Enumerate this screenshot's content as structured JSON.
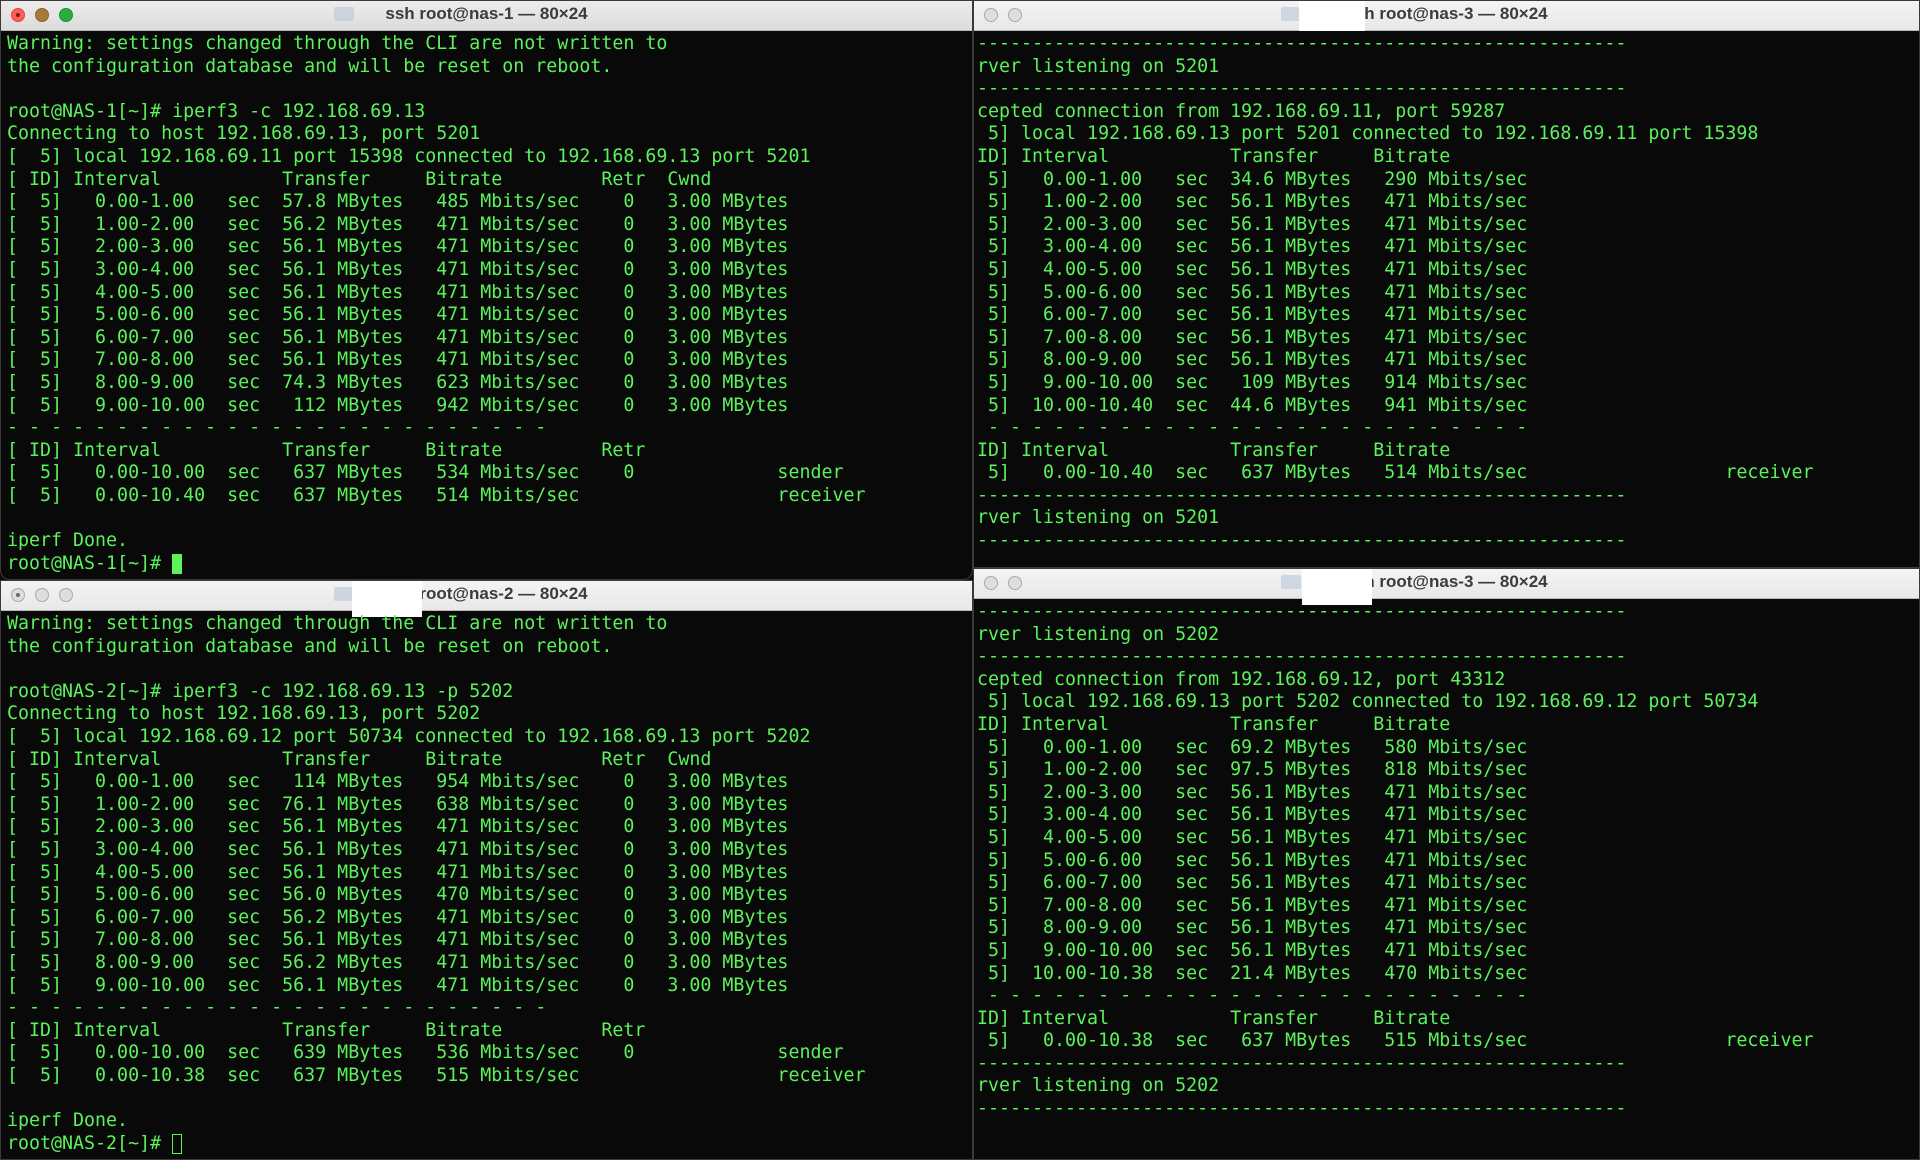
{
  "windows": {
    "top_left": {
      "title": "ssh root@nas-1 — 80×24",
      "text": "Warning: settings changed through the CLI are not written to\nthe configuration database and will be reset on reboot.\n\nroot@NAS-1[~]# iperf3 -c 192.168.69.13\nConnecting to host 192.168.69.13, port 5201\n[  5] local 192.168.69.11 port 15398 connected to 192.168.69.13 port 5201\n[ ID] Interval           Transfer     Bitrate         Retr  Cwnd\n[  5]   0.00-1.00   sec  57.8 MBytes   485 Mbits/sec    0   3.00 MBytes\n[  5]   1.00-2.00   sec  56.2 MBytes   471 Mbits/sec    0   3.00 MBytes\n[  5]   2.00-3.00   sec  56.1 MBytes   471 Mbits/sec    0   3.00 MBytes\n[  5]   3.00-4.00   sec  56.1 MBytes   471 Mbits/sec    0   3.00 MBytes\n[  5]   4.00-5.00   sec  56.1 MBytes   471 Mbits/sec    0   3.00 MBytes\n[  5]   5.00-6.00   sec  56.1 MBytes   471 Mbits/sec    0   3.00 MBytes\n[  5]   6.00-7.00   sec  56.1 MBytes   471 Mbits/sec    0   3.00 MBytes\n[  5]   7.00-8.00   sec  56.1 MBytes   471 Mbits/sec    0   3.00 MBytes\n[  5]   8.00-9.00   sec  74.3 MBytes   623 Mbits/sec    0   3.00 MBytes\n[  5]   9.00-10.00  sec   112 MBytes   942 Mbits/sec    0   3.00 MBytes\n- - - - - - - - - - - - - - - - - - - - - - - - -\n[ ID] Interval           Transfer     Bitrate         Retr\n[  5]   0.00-10.00  sec   637 MBytes   534 Mbits/sec    0             sender\n[  5]   0.00-10.40  sec   637 MBytes   514 Mbits/sec                  receiver\n\niperf Done.\nroot@NAS-1[~]# "
    },
    "top_right": {
      "title": "ssh root@nas-3 — 80×24",
      "text": "-----------------------------------------------------------\nrver listening on 5201\n-----------------------------------------------------------\ncepted connection from 192.168.69.11, port 59287\n 5] local 192.168.69.13 port 5201 connected to 192.168.69.11 port 15398\nID] Interval           Transfer     Bitrate\n 5]   0.00-1.00   sec  34.6 MBytes   290 Mbits/sec\n 5]   1.00-2.00   sec  56.1 MBytes   471 Mbits/sec\n 5]   2.00-3.00   sec  56.1 MBytes   471 Mbits/sec\n 5]   3.00-4.00   sec  56.1 MBytes   471 Mbits/sec\n 5]   4.00-5.00   sec  56.1 MBytes   471 Mbits/sec\n 5]   5.00-6.00   sec  56.1 MBytes   471 Mbits/sec\n 5]   6.00-7.00   sec  56.1 MBytes   471 Mbits/sec\n 5]   7.00-8.00   sec  56.1 MBytes   471 Mbits/sec\n 5]   8.00-9.00   sec  56.1 MBytes   471 Mbits/sec\n 5]   9.00-10.00  sec   109 MBytes   914 Mbits/sec\n 5]  10.00-10.40  sec  44.6 MBytes   941 Mbits/sec\n - - - - - - - - - - - - - - - - - - - - - - - - -\nID] Interval           Transfer     Bitrate\n 5]   0.00-10.40  sec   637 MBytes   514 Mbits/sec                  receiver\n-----------------------------------------------------------\nrver listening on 5201\n-----------------------------------------------------------"
    },
    "bottom_left": {
      "title": "ssh root@nas-2 — 80×24",
      "text": "Warning: settings changed through the CLI are not written to\nthe configuration database and will be reset on reboot.\n\nroot@NAS-2[~]# iperf3 -c 192.168.69.13 -p 5202\nConnecting to host 192.168.69.13, port 5202\n[  5] local 192.168.69.12 port 50734 connected to 192.168.69.13 port 5202\n[ ID] Interval           Transfer     Bitrate         Retr  Cwnd\n[  5]   0.00-1.00   sec   114 MBytes   954 Mbits/sec    0   3.00 MBytes\n[  5]   1.00-2.00   sec  76.1 MBytes   638 Mbits/sec    0   3.00 MBytes\n[  5]   2.00-3.00   sec  56.1 MBytes   471 Mbits/sec    0   3.00 MBytes\n[  5]   3.00-4.00   sec  56.1 MBytes   471 Mbits/sec    0   3.00 MBytes\n[  5]   4.00-5.00   sec  56.1 MBytes   471 Mbits/sec    0   3.00 MBytes\n[  5]   5.00-6.00   sec  56.0 MBytes   470 Mbits/sec    0   3.00 MBytes\n[  5]   6.00-7.00   sec  56.2 MBytes   471 Mbits/sec    0   3.00 MBytes\n[  5]   7.00-8.00   sec  56.1 MBytes   471 Mbits/sec    0   3.00 MBytes\n[  5]   8.00-9.00   sec  56.2 MBytes   471 Mbits/sec    0   3.00 MBytes\n[  5]   9.00-10.00  sec  56.1 MBytes   471 Mbits/sec    0   3.00 MBytes\n- - - - - - - - - - - - - - - - - - - - - - - - -\n[ ID] Interval           Transfer     Bitrate         Retr\n[  5]   0.00-10.00  sec   639 MBytes   536 Mbits/sec    0             sender\n[  5]   0.00-10.38  sec   637 MBytes   515 Mbits/sec                  receiver\n\niperf Done.\nroot@NAS-2[~]# "
    },
    "bottom_right": {
      "title": "ssh root@nas-3 — 80×24",
      "text": "-----------------------------------------------------------\nrver listening on 5202\n-----------------------------------------------------------\ncepted connection from 192.168.69.12, port 43312\n 5] local 192.168.69.13 port 5202 connected to 192.168.69.12 port 50734\nID] Interval           Transfer     Bitrate\n 5]   0.00-1.00   sec  69.2 MBytes   580 Mbits/sec\n 5]   1.00-2.00   sec  97.5 MBytes   818 Mbits/sec\n 5]   2.00-3.00   sec  56.1 MBytes   471 Mbits/sec\n 5]   3.00-4.00   sec  56.1 MBytes   471 Mbits/sec\n 5]   4.00-5.00   sec  56.1 MBytes   471 Mbits/sec\n 5]   5.00-6.00   sec  56.1 MBytes   471 Mbits/sec\n 5]   6.00-7.00   sec  56.1 MBytes   471 Mbits/sec\n 5]   7.00-8.00   sec  56.1 MBytes   471 Mbits/sec\n 5]   8.00-9.00   sec  56.1 MBytes   471 Mbits/sec\n 5]   9.00-10.00  sec  56.1 MBytes   471 Mbits/sec\n 5]  10.00-10.38  sec  21.4 MBytes   470 Mbits/sec\n - - - - - - - - - - - - - - - - - - - - - - - - -\nID] Interval           Transfer     Bitrate\n 5]   0.00-10.38  sec   637 MBytes   515 Mbits/sec                  receiver\n-----------------------------------------------------------\nrver listening on 5202\n-----------------------------------------------------------"
    }
  },
  "colors": {
    "terminal_text": "#5cf25c",
    "terminal_bg": "#080a09"
  }
}
